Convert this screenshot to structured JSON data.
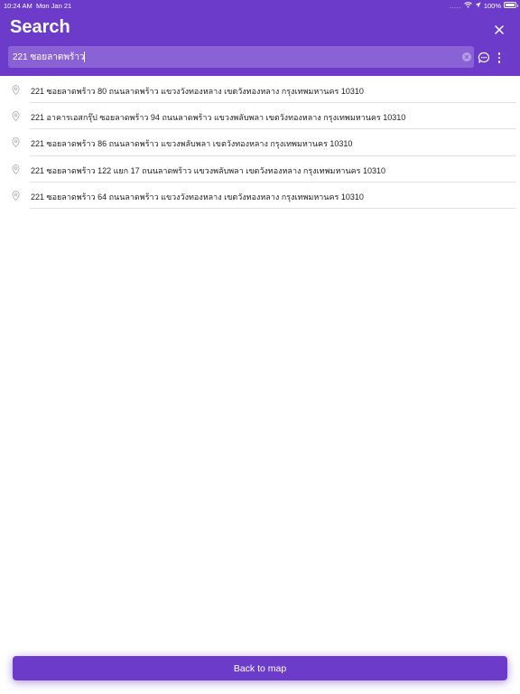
{
  "status_bar": {
    "time": "10:24 AM",
    "date": "Mon Jan 21",
    "signal_dots": ".....",
    "battery": "100%",
    "icons": [
      "wifi-icon",
      "location-arrow-icon",
      "battery-icon"
    ]
  },
  "header": {
    "title": "Search",
    "close_icon": "close-icon"
  },
  "search": {
    "value": "221 ซอยลาดพร้าว",
    "clear_icon": "clear-icon",
    "feedback_icon": "chat-bubble-icon",
    "more_icon": "more-vertical-icon"
  },
  "results": [
    {
      "text": "221 ซอยลาดพร้าว 80 ถนนลาดพร้าว แขวงวังทองหลาง เขตวังทองหลาง กรุงเทพมหานคร 10310"
    },
    {
      "text": "221 อาคารเอสกรุ๊ป ซอยลาดพร้าว 94 ถนนลาดพร้าว แขวงพลับพลา เขตวังทองหลาง กรุงเทพมหานคร 10310"
    },
    {
      "text": "221 ซอยลาดพร้าว 86 ถนนลาดพร้าว แขวงพลับพลา เขตวังทองหลาง กรุงเทพมหานคร 10310"
    },
    {
      "text": "221 ซอยลาดพร้าว 122 แยก 17 ถนนลาดพร้าว แขวงพลับพลา เขตวังทองหลาง กรุงเทพมหานคร 10310"
    },
    {
      "text": "221 ซอยลาดพร้าว 64 ถนนลาดพร้าว แขวงวังทองหลาง เขตวังทองหลาง กรุงเทพมหานคร 10310"
    }
  ],
  "footer": {
    "back_label": "Back to map"
  },
  "colors": {
    "accent": "#6c3bc9",
    "search_field": "#8a62d6",
    "divider": "#e3e3e3"
  }
}
